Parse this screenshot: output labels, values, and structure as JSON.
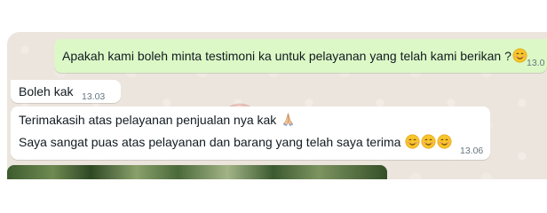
{
  "messages": {
    "outgoing": {
      "text": "Apakah kami boleh minta testimoni ka untuk pelayanan yang telah kami berikan ?",
      "time": "13.0"
    },
    "reply_short": {
      "text": "Boleh kak",
      "time": "13.03"
    },
    "reply_long": {
      "line1": "Terimakasih atas pelayanan penjualan nya kak",
      "line2": "Saya sangat puas atas pelayanan dan barang yang telah saya terima",
      "time": "13.06"
    }
  },
  "icons": {
    "smile": "smiling-face-emoji",
    "pray": "folded-hands-emoji",
    "watermark": "globe-logo-watermark"
  },
  "colors": {
    "chat_bg": "#ece5dd",
    "outgoing_bubble": "#dcf8c6",
    "incoming_bubble": "#ffffff",
    "time_text": "#667781"
  }
}
